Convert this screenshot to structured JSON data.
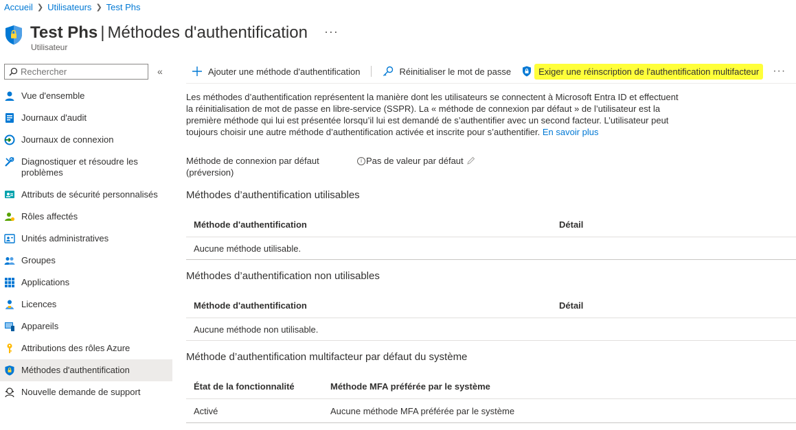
{
  "breadcrumb": {
    "items": [
      "Accueil",
      "Utilisateurs",
      "Test Phs"
    ]
  },
  "page": {
    "title_bold": "Test Phs",
    "title_separator": "|",
    "title_rest": "Méthodes d'authentification",
    "more": "···",
    "subtitle": "Utilisateur"
  },
  "search": {
    "placeholder": "Rechercher",
    "collapse": "«"
  },
  "nav": [
    {
      "label": "Vue d'ensemble",
      "icon": "user-icon"
    },
    {
      "label": "Journaux d'audit",
      "icon": "audit-log-icon"
    },
    {
      "label": "Journaux de connexion",
      "icon": "sign-in-log-icon"
    },
    {
      "label": "Diagnostiquer et résoudre les problèmes",
      "icon": "wrench-icon"
    },
    {
      "label": "Attributs de sécurité personnalisés",
      "icon": "security-attributes-icon"
    },
    {
      "label": "Rôles affectés",
      "icon": "roles-icon"
    },
    {
      "label": "Unités administratives",
      "icon": "admin-units-icon"
    },
    {
      "label": "Groupes",
      "icon": "groups-icon"
    },
    {
      "label": "Applications",
      "icon": "apps-grid-icon"
    },
    {
      "label": "Licences",
      "icon": "licenses-icon"
    },
    {
      "label": "Appareils",
      "icon": "devices-icon"
    },
    {
      "label": "Attributions des rôles Azure",
      "icon": "key-icon"
    },
    {
      "label": "Méthodes d'authentification",
      "icon": "shield-icon",
      "active": true
    },
    {
      "label": "Nouvelle demande de support",
      "icon": "support-icon"
    }
  ],
  "toolbar": {
    "add": "Ajouter une méthode d'authentification",
    "reset": "Réinitialiser le mot de passe",
    "require": "Exiger une réinscription de l'authentification multifacteur",
    "more": "···"
  },
  "description": {
    "text": "Les méthodes d’authentification représentent la manière dont les utilisateurs se connectent à Microsoft Entra ID et effectuent la réinitialisation de mot de passe en libre-service (SSPR). La « méthode de connexion par défaut » de l’utilisateur est la première méthode qui lui est présentée lorsqu’il lui est demandé de s’authentifier avec un second facteur. L’utilisateur peut toujours choisir une autre méthode d’authentification activée et inscrite pour s’authentifier.",
    "link": "En savoir plus"
  },
  "default_method": {
    "label": "Méthode de connexion par défaut (préversion)",
    "info": "i",
    "value": "Pas de valeur par défaut"
  },
  "usable": {
    "heading": "Méthodes d’authentification utilisables",
    "col1": "Méthode d'authentification",
    "col2": "Détail",
    "empty": "Aucune méthode utilisable."
  },
  "unusable": {
    "heading": "Méthodes d’authentification non utilisables",
    "col1": "Méthode d'authentification",
    "col2": "Détail",
    "empty": "Aucune méthode non utilisable."
  },
  "mfa": {
    "heading": "Méthode d’authentification multifacteur par défaut du système",
    "col1": "État de la fonctionnalité",
    "col2": "Méthode MFA préférée par le système",
    "state": "Activé",
    "method": "Aucune méthode MFA préférée par le système"
  },
  "colors": {
    "accent": "#0078d4",
    "highlight": "#ffff3a",
    "active_nav": "#edebe9"
  }
}
